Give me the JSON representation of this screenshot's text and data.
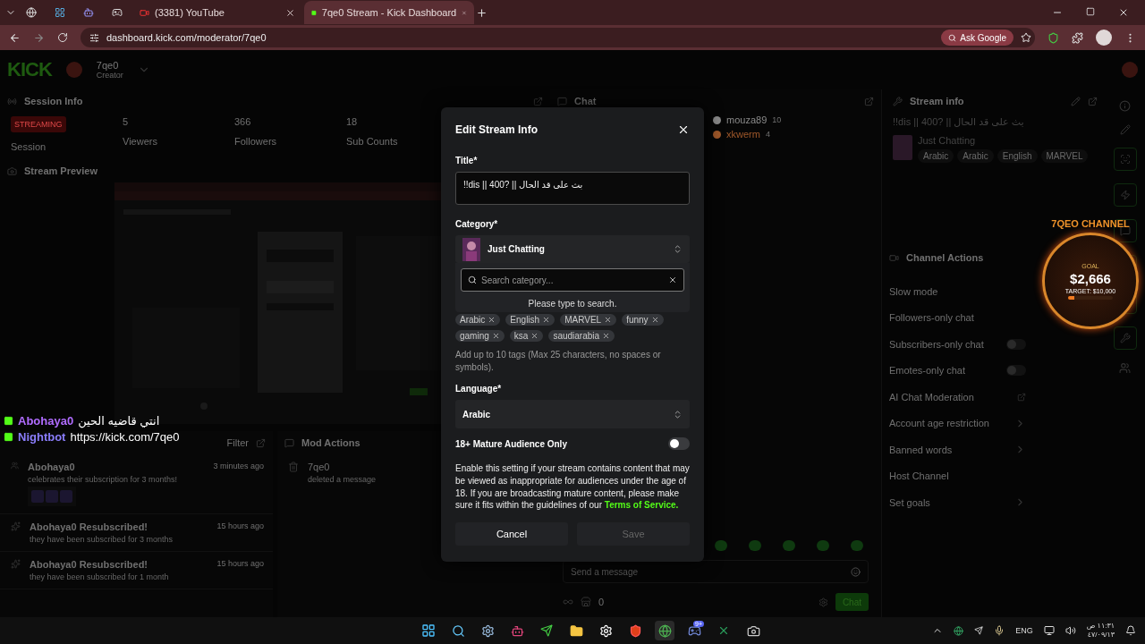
{
  "browser": {
    "tabs": [
      {
        "kind": "icon",
        "selected": false
      },
      {
        "kind": "icon",
        "selected": false
      },
      {
        "kind": "icon",
        "selected": false
      },
      {
        "kind": "icon",
        "selected": false
      },
      {
        "kind": "page",
        "label": "(3381) YouTube",
        "selected": false
      },
      {
        "kind": "page",
        "label": "7qe0 Stream - Kick Dashboard",
        "selected": true
      }
    ],
    "url": "dashboard.kick.com/moderator/7qe0",
    "ask": "Ask Google"
  },
  "header": {
    "logo": "KICK",
    "channel": "7qe0",
    "role": "Creator"
  },
  "session": {
    "title": "Session Info",
    "badge": "STREAMING",
    "badge_label": "Session",
    "stats": [
      {
        "value": "5",
        "label": "Viewers"
      },
      {
        "value": "366",
        "label": "Followers"
      },
      {
        "value": "18",
        "label": "Sub Counts"
      }
    ]
  },
  "preview": {
    "title": "Stream Preview"
  },
  "overlay_chat": [
    {
      "user": "Abohaya0",
      "text": "انتي قاضيه الحين",
      "color": "#b06cff"
    },
    {
      "user": "Nightbot",
      "text": "https://kick.com/7qe0",
      "color": "#8a7dfa"
    }
  ],
  "activity": {
    "filter": "Filter",
    "items": [
      {
        "kind": "sub",
        "title": "Abohaya0",
        "text": "celebrates their subscription for 3 months!",
        "time": "3 minutes ago"
      },
      {
        "kind": "resub",
        "title": "Abohaya0 Resubscribed!",
        "text": "they have been subscribed for 3 months",
        "time": "15 hours ago"
      },
      {
        "kind": "resub",
        "title": "Abohaya0 Resubscribed!",
        "text": "they have been subscribed for 1 month",
        "time": "15 hours ago"
      }
    ]
  },
  "mod_actions": {
    "title": "Mod Actions",
    "items": [
      {
        "user": "7qe0",
        "text": "deleted a message"
      }
    ]
  },
  "chat": {
    "title": "Chat",
    "users": [
      {
        "name": "mouza89",
        "count": "10",
        "color": "#8a8a8a"
      },
      {
        "name": "xkwerm",
        "count": "4",
        "color": "#a0582a"
      }
    ],
    "placeholder": "Send a message",
    "points": "0",
    "send": "Chat"
  },
  "stream_info": {
    "title": "Stream info",
    "stream_title": "!!dis || 400? || بث على قد الحال",
    "category": "Just Chatting",
    "tags": [
      "Arabic",
      "Arabic",
      "English",
      "MARVEL"
    ]
  },
  "goal": {
    "title": "7QEO CHANNEL",
    "label": "GOAL",
    "amount": "$2,666",
    "target": "TARGET: $10,000",
    "level": 0.13
  },
  "channel_actions": {
    "title": "Channel Actions",
    "items": [
      {
        "label": "Slow mode",
        "kind": "plain"
      },
      {
        "label": "Followers-only chat",
        "kind": "plain"
      },
      {
        "label": "Subscribers-only chat",
        "kind": "toggle",
        "on": false
      },
      {
        "label": "Emotes-only chat",
        "kind": "toggle",
        "on": false
      },
      {
        "label": "AI Chat Moderation",
        "kind": "external"
      },
      {
        "label": "Account age restriction",
        "kind": "arrow"
      },
      {
        "label": "Banned words",
        "kind": "arrow"
      },
      {
        "label": "Host Channel",
        "kind": "plain"
      },
      {
        "label": "Set goals",
        "kind": "arrow"
      }
    ]
  },
  "modal": {
    "title": "Edit Stream Info",
    "title_label": "Title*",
    "title_value": "!!dis || 400? || بث على قد الحال",
    "category_label": "Category*",
    "category": "Just Chatting",
    "search_placeholder": "Search category...",
    "search_hint": "Please type to search.",
    "tags": [
      "Arabic",
      "English",
      "MARVEL",
      "funny",
      "gaming",
      "ksa",
      "saudiarabia"
    ],
    "tags_hint": "Add up to 10 tags (Max 25 characters, no spaces or symbols).",
    "language_label": "Language*",
    "language": "Arabic",
    "mature_label": "18+ Mature Audience Only",
    "mature_on": false,
    "notice": "Enable this setting if your stream contains content that may be viewed as inappropriate for audiences under the age of 18. If you are broadcasting mature content, please make sure it fits within the guidelines of our ",
    "notice_link": "Terms of Service.",
    "cancel": "Cancel",
    "save": "Save",
    "save_disabled": true
  },
  "taskbar": {
    "discord_badge": "9+",
    "lang": "ENG",
    "time": "١١:٣١ ص",
    "date": "٤٧/٠٩/١٣"
  }
}
